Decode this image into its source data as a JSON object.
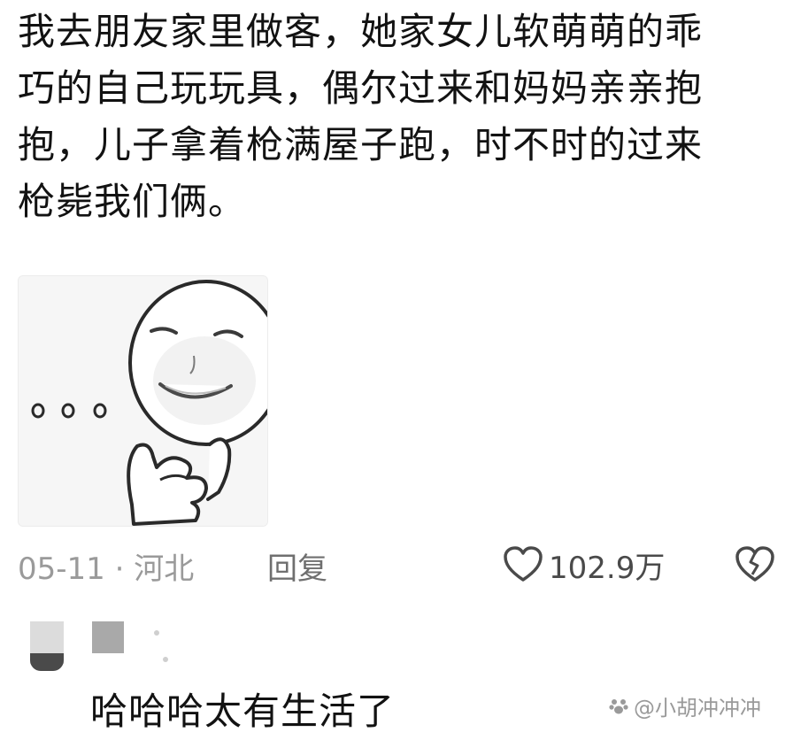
{
  "post": {
    "lines": [
      "我去朋友家里做客，她家女儿软萌萌的乖",
      "巧的自己玩玩具，偶尔过来和妈妈亲亲抱",
      "抱，儿子拿着枪满屋子跑，时不时的过来",
      "枪毙我们俩。"
    ]
  },
  "sticker": {
    "icon": "meme-face-sticker",
    "dots_icon": "ellipsis-dots"
  },
  "meta": {
    "date_location": "05-11 · 河北",
    "reply_label": "回复",
    "like_count": "102.9万",
    "like_icon": "heart-outline-icon",
    "dislike_icon": "broken-heart-icon"
  },
  "reply": {
    "text": "哈哈哈太有生活了"
  },
  "watermark": {
    "text": "@小胡冲冲冲",
    "icon": "paw-icon"
  }
}
